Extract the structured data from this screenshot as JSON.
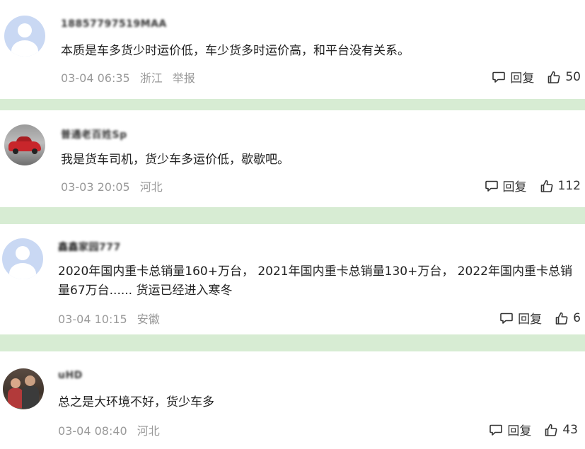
{
  "labels": {
    "reply": "回复",
    "report": "举报"
  },
  "colors": {
    "separator": "#d7ecd3",
    "meta": "#999999"
  },
  "comments": [
    {
      "username": "18857797519MAA",
      "avatar": "default-avatar",
      "text": [
        "本质是车多货少时运价低，车少货多时运价高，和平台没有关系。"
      ],
      "date": "03-04 06:35",
      "region": "浙江",
      "likes": "50"
    },
    {
      "username": "普通老百姓Sp",
      "avatar": "red-car-avatar",
      "text": [
        "我是货车司机，货少车多运价低，歇歇吧。"
      ],
      "date": "03-03 20:05",
      "region": "河北",
      "likes": "112"
    },
    {
      "username": "鑫鑫家园777",
      "avatar": "default-avatar",
      "text": [
        "2020年国内重卡总销量160+万台， 2021年国内重卡总销量130+万台， 2022年国内重卡总销",
        "量67万台...... 货运已经进入寒冬"
      ],
      "date": "03-04 10:15",
      "region": "安徽",
      "likes": "6"
    },
    {
      "username": "uHD",
      "avatar": "family-photo-avatar",
      "text": [
        "总之是大环境不好，货少车多"
      ],
      "date": "03-04 08:40",
      "region": "河北",
      "likes": "43"
    }
  ]
}
